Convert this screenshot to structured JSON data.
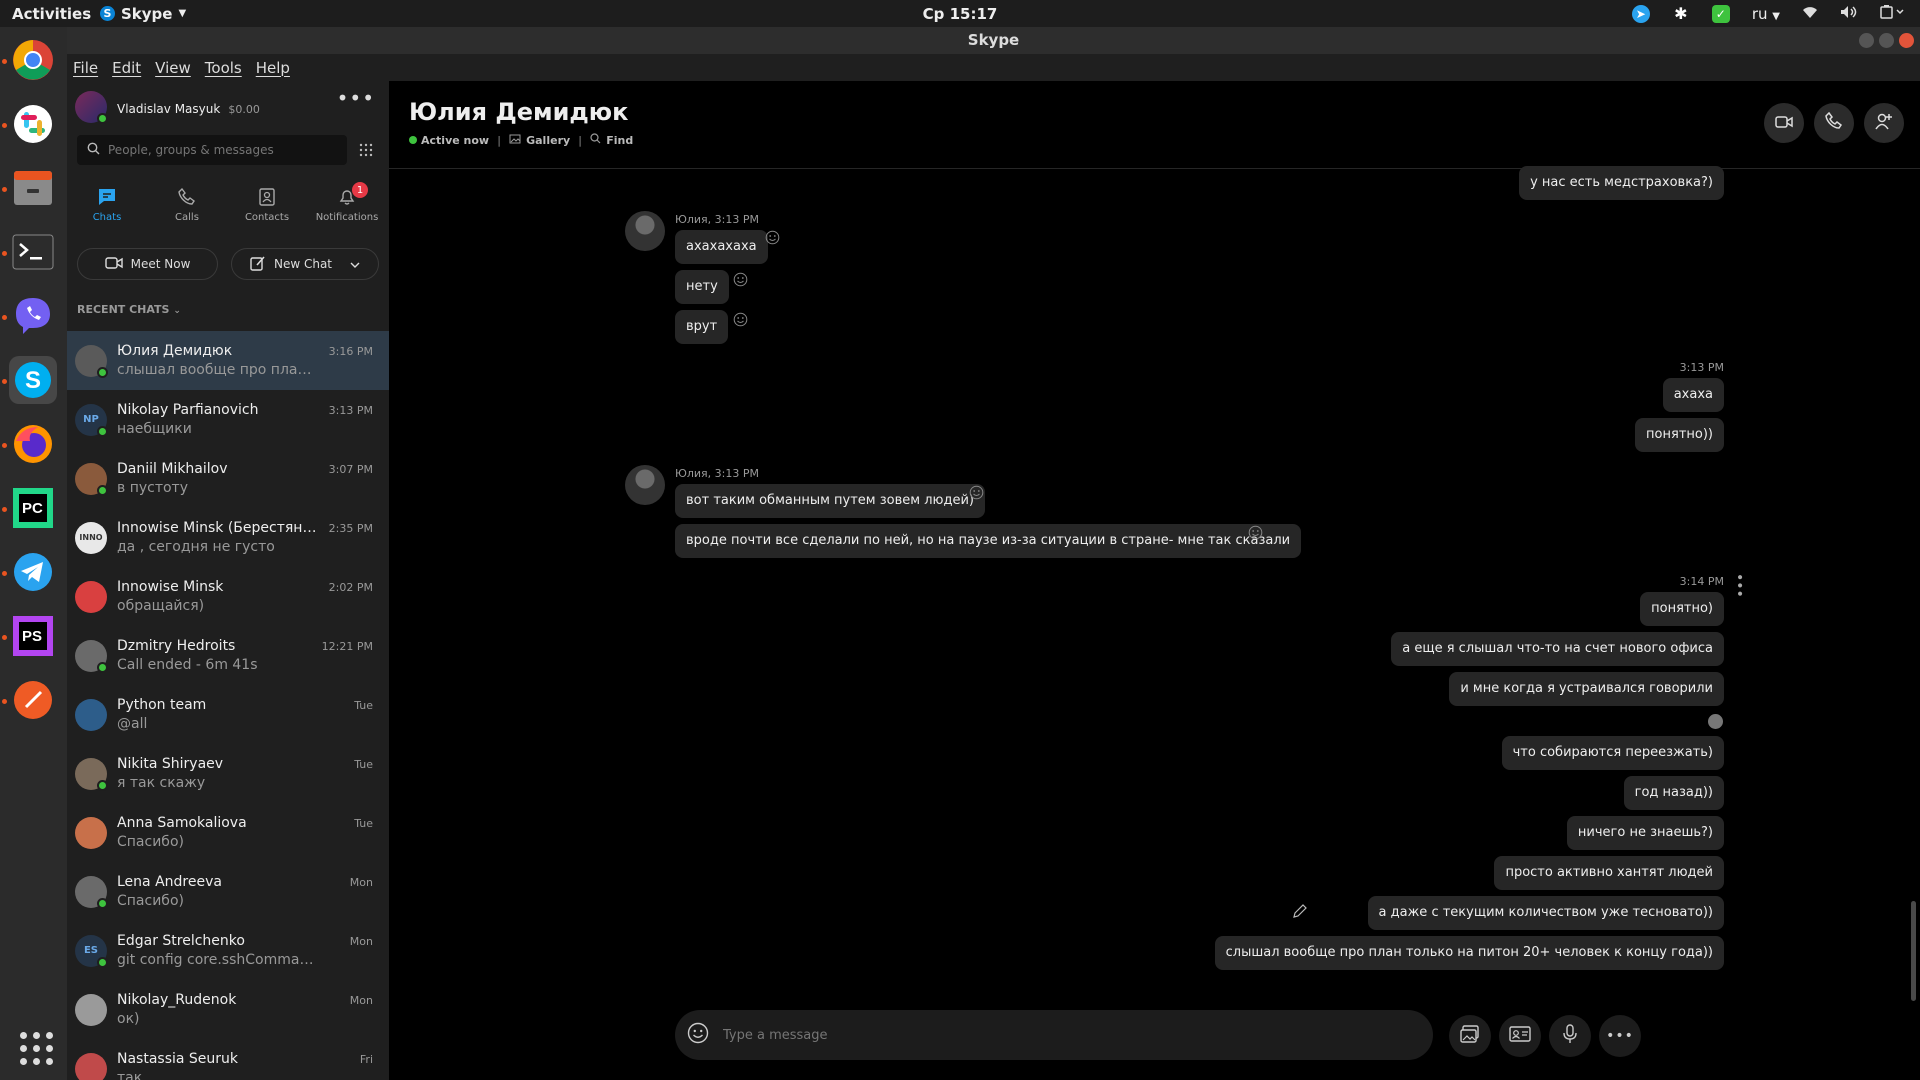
{
  "topbar": {
    "activities": "Activities",
    "app_name": "Skype",
    "clock": "Ср 15:17",
    "lang": "ru"
  },
  "window": {
    "title": "Skype"
  },
  "menubar": [
    "File",
    "Edit",
    "View",
    "Tools",
    "Help"
  ],
  "profile": {
    "name": "Vladislav Masyuk",
    "credit": "$0.00"
  },
  "search": {
    "placeholder": "People, groups & messages"
  },
  "nav_tabs": [
    {
      "label": "Chats",
      "icon": "chat-icon"
    },
    {
      "label": "Calls",
      "icon": "phone-icon"
    },
    {
      "label": "Contacts",
      "icon": "contacts-icon"
    },
    {
      "label": "Notifications",
      "icon": "bell-icon",
      "badge": "1"
    }
  ],
  "actions": {
    "meet_now": "Meet Now",
    "new_chat": "New Chat"
  },
  "recent_label": "RECENT CHATS",
  "chats": [
    {
      "name": "Юлия Демидюк",
      "preview": "слышал вообще про план то...",
      "time": "3:16 PM",
      "initials": "",
      "color": "#5a5a5a",
      "online": true
    },
    {
      "name": "Nikolay Parfianovich",
      "preview": "наебщики",
      "time": "3:13 PM",
      "initials": "NP",
      "color": "#243447",
      "online": true
    },
    {
      "name": "Daniil Mikhailov",
      "preview": "в пустоту",
      "time": "3:07 PM",
      "initials": "",
      "color": "#8a5a3c",
      "online": true
    },
    {
      "name": "Innowise Minsk (Берестянск...",
      "preview": " да , сегодня не густо",
      "time": "2:35 PM",
      "initials": "INNO",
      "color": "#e8e8e8",
      "online": false
    },
    {
      "name": "Innowise Minsk",
      "preview": "обращайся)",
      "time": "2:02 PM",
      "initials": "",
      "color": "#d94040",
      "online": false
    },
    {
      "name": "Dzmitry Hedroits",
      "preview": "Call ended - 6m 41s",
      "time": "12:21 PM",
      "initials": "",
      "color": "#6a6a6a",
      "online": true
    },
    {
      "name": "Python team",
      "preview": "@all",
      "time": "Tue",
      "initials": "",
      "color": "#2d5d8a",
      "online": false
    },
    {
      "name": "Nikita Shiryaev",
      "preview": "я так скажу",
      "time": "Tue",
      "initials": "",
      "color": "#7a6a5a",
      "online": true
    },
    {
      "name": "Anna Samokaliova",
      "preview": "Спасибо)",
      "time": "Tue",
      "initials": "",
      "color": "#c8704a",
      "online": false
    },
    {
      "name": "Lena Andreeva",
      "preview": "Спасибо)",
      "time": "Mon",
      "initials": "",
      "color": "#6a6a6a",
      "online": true
    },
    {
      "name": "Edgar Strelchenko",
      "preview": "git config core.sshCommand 'ssh...",
      "time": "Mon",
      "initials": "ES",
      "color": "#243447",
      "online": true
    },
    {
      "name": "Nikolay_Rudenok",
      "preview": "ок)",
      "time": "Mon",
      "initials": "",
      "color": "#9a9a9a",
      "online": false
    },
    {
      "name": "Nastassia Seuruk",
      "preview": "так",
      "time": "Fri",
      "initials": "",
      "color": "#c04a4a",
      "online": false
    }
  ],
  "conversation": {
    "title": "Юлия Демидюк",
    "status": "Active now",
    "gallery": "Gallery",
    "find": "Find",
    "incoming_groups": [
      {
        "sender": "Юлия, 3:13 PM",
        "messages": [
          "ахахахаха",
          "нету",
          "врут"
        ]
      },
      {
        "sender": "Юлия, 3:13 PM",
        "messages": [
          "вот таким обманным путем зовем людей)",
          "вроде почти все сделали по ней, но на паузе из-за ситуации в стране- мне так сказали"
        ]
      }
    ],
    "outgoing_top": "у нас есть медстраховка?)",
    "outgoing_group_1": {
      "time": "3:13 PM",
      "messages": [
        "ахаха",
        "понятно))"
      ]
    },
    "outgoing_group_2": {
      "time": "3:14 PM",
      "messages": [
        "понятно)",
        "а еще я слышал что-то на счет нового офиса",
        "и мне когда я устраивался говорили",
        "что собираются переезжать)",
        "год назад))",
        "ничего не знаешь?)",
        "просто активно хантят людей",
        "а даже с текущим количеством уже тесновато))",
        "слышал вообще про план только на питон 20+ человек к концу года))"
      ]
    },
    "composer_placeholder": "Type a message"
  }
}
